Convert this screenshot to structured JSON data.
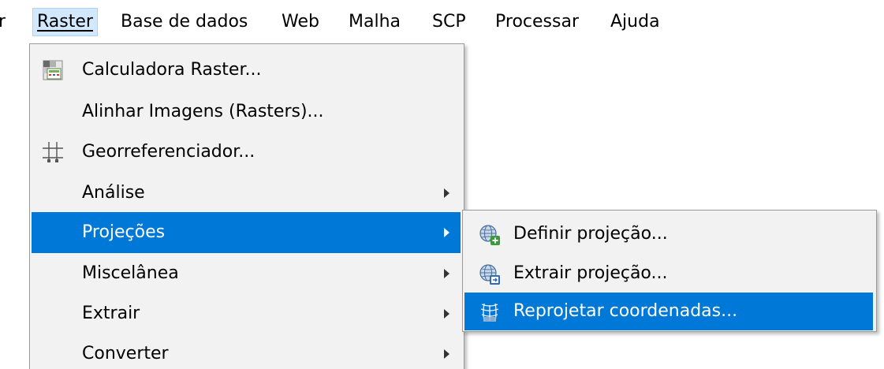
{
  "menubar": {
    "items": [
      {
        "label": "r",
        "active": false
      },
      {
        "label": "Raster",
        "active": true
      },
      {
        "label": "Base de dados",
        "active": false
      },
      {
        "label": "Web",
        "active": false
      },
      {
        "label": "Malha",
        "active": false
      },
      {
        "label": "SCP",
        "active": false
      },
      {
        "label": "Processar",
        "active": false
      },
      {
        "label": "Ajuda",
        "active": false
      }
    ]
  },
  "raster_menu": {
    "items": [
      {
        "label": "Calculadora Raster...",
        "icon": "raster-calculator-icon",
        "submenu": false
      },
      {
        "label": "Alinhar Imagens (Rasters)...",
        "icon": null,
        "submenu": false
      },
      {
        "label": "Georreferenciador...",
        "icon": "georeferencer-grid-icon",
        "submenu": false
      },
      {
        "label": "Análise",
        "icon": null,
        "submenu": true
      },
      {
        "label": "Projeções",
        "icon": null,
        "submenu": true,
        "highlighted": true
      },
      {
        "label": "Miscelânea",
        "icon": null,
        "submenu": true
      },
      {
        "label": "Extrair",
        "icon": null,
        "submenu": true
      },
      {
        "label": "Converter",
        "icon": null,
        "submenu": true
      }
    ]
  },
  "projections_submenu": {
    "items": [
      {
        "label": "Definir projeção...",
        "icon": "globe-add-icon"
      },
      {
        "label": "Extrair projeção...",
        "icon": "globe-extract-icon"
      },
      {
        "label": "Reprojetar coordenadas...",
        "icon": "reproject-grid-icon",
        "highlighted": true
      }
    ]
  },
  "colors": {
    "highlight": "#0078d7",
    "active_menubar": "#d1e8ff",
    "menu_background": "#f2f2f2"
  }
}
